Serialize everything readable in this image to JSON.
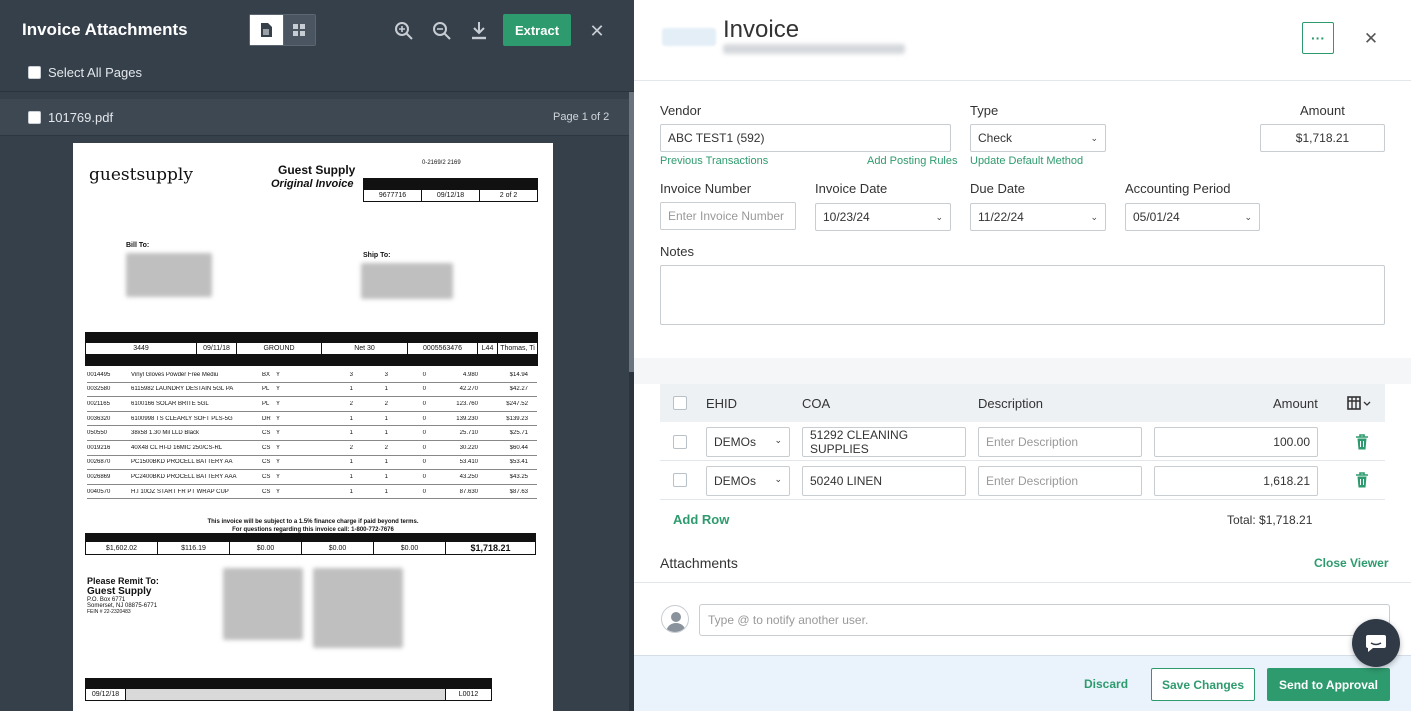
{
  "viewer": {
    "title": "Invoice Attachments",
    "extract_label": "Extract",
    "select_all_label": "Select All Pages",
    "file_name": "101769.pdf",
    "page_indicator": "Page 1 of 2"
  },
  "document": {
    "logo_text": "guestsupply",
    "company": "Guest Supply",
    "doc_type": "Original Invoice",
    "ref_code": "0-2169/2 2169",
    "header_values": [
      "9677716",
      "09/12/18",
      "2 of 2"
    ],
    "bill_to_label": "Bill To:",
    "ship_to_label": "Ship To:",
    "order_values": [
      "3449",
      "09/11/18",
      "GROUND",
      "Net 30",
      "0005563476",
      "L44",
      "Thomas, Ti"
    ],
    "items": [
      {
        "code": "0014495",
        "desc": "Vinyl Gloves Powder Free Mediu",
        "um": "BX",
        "tx": "Y",
        "q1": "3",
        "q2": "3",
        "bo": "0",
        "price": "4.980",
        "ext": "$14.94"
      },
      {
        "code": "0032580",
        "desc": "6115982 LAUNDRY DESTAIN 5GL PA",
        "um": "PL",
        "tx": "Y",
        "q1": "1",
        "q2": "1",
        "bo": "0",
        "price": "42.270",
        "ext": "$42.27"
      },
      {
        "code": "0021165",
        "desc": "6100166 SOLAR BRITE 5GL",
        "um": "PL",
        "tx": "Y",
        "q1": "2",
        "q2": "2",
        "bo": "0",
        "price": "123.760",
        "ext": "$247.52"
      },
      {
        "code": "0036320",
        "desc": "6100998 TS CLEARLY SOFT PLS-5G",
        "um": "DR",
        "tx": "Y",
        "q1": "1",
        "q2": "1",
        "bo": "0",
        "price": "139.230",
        "ext": "$139.23"
      },
      {
        "code": "050550",
        "desc": "38x58 1.30 Mil LLD Black",
        "um": "CS",
        "tx": "Y",
        "q1": "1",
        "q2": "1",
        "bo": "0",
        "price": "25.710",
        "ext": "$25.71"
      },
      {
        "code": "0019216",
        "desc": "40X48 CL HI-D 16MIC 250/CS-RL",
        "um": "CS",
        "tx": "Y",
        "q1": "2",
        "q2": "2",
        "bo": "0",
        "price": "30.220",
        "ext": "$60.44"
      },
      {
        "code": "0026870",
        "desc": "PC1500BKD PROCELL BATTERY AA",
        "um": "CS",
        "tx": "Y",
        "q1": "1",
        "q2": "1",
        "bo": "0",
        "price": "53.410",
        "ext": "$53.41"
      },
      {
        "code": "0026869",
        "desc": "PC2400BKD PROCELL BATTERY AAA",
        "um": "CS",
        "tx": "Y",
        "q1": "1",
        "q2": "1",
        "bo": "0",
        "price": "43.250",
        "ext": "$43.25"
      },
      {
        "code": "0040570",
        "desc": "H.I 10OZ START FR PT WRAP CUP",
        "um": "CS",
        "tx": "Y",
        "q1": "1",
        "q2": "1",
        "bo": "0",
        "price": "87.630",
        "ext": "$87.63"
      }
    ],
    "finance_note": "This invoice will be subject to a 1.5% finance charge if paid beyond terms.",
    "questions_note": "For questions regarding this invoice call: 1-800-772-7676",
    "totals": [
      "$1,602.02",
      "$116.19",
      "$0.00",
      "$0.00",
      "$0.00",
      "$1,718.21"
    ],
    "remit_label": "Please Remit To:",
    "remit_name": "Guest Supply",
    "remit_addr1": "P.O. Box 6771",
    "remit_addr2": "Somerset, NJ 08875-6771",
    "remit_fein": "FEIN # 22-2320483",
    "bottom_values": [
      "09/12/18",
      "L0012"
    ]
  },
  "form": {
    "title": "Invoice",
    "more_label": "···",
    "vendor_label": "Vendor",
    "vendor_value": "ABC TEST1 (592)",
    "previous_transactions": "Previous Transactions",
    "add_posting_rules": "Add Posting Rules",
    "type_label": "Type",
    "type_value": "Check",
    "update_default_method": "Update Default Method",
    "amount_label": "Amount",
    "amount_value": "$1,718.21",
    "invoice_number_label": "Invoice Number",
    "invoice_number_placeholder": "Enter Invoice Number",
    "invoice_date_label": "Invoice Date",
    "invoice_date_value": "10/23/24",
    "due_date_label": "Due Date",
    "due_date_value": "11/22/24",
    "accounting_period_label": "Accounting Period",
    "accounting_period_value": "05/01/24",
    "notes_label": "Notes"
  },
  "lines": {
    "headers": {
      "ehid": "EHID",
      "coa": "COA",
      "description": "Description",
      "amount": "Amount"
    },
    "rows": [
      {
        "ehid": "DEMOs",
        "coa": "51292 CLEANING SUPPLIES",
        "desc_placeholder": "Enter Description",
        "amount": "100.00"
      },
      {
        "ehid": "DEMOs",
        "coa": "50240 LINEN",
        "desc_placeholder": "Enter Description",
        "amount": "1,618.21"
      }
    ],
    "add_row": "Add Row",
    "total": "Total: $1,718.21"
  },
  "attachments": {
    "label": "Attachments",
    "close_viewer": "Close Viewer",
    "comment_placeholder": "Type @ to notify another user."
  },
  "footer": {
    "discard": "Discard",
    "save": "Save Changes",
    "send": "Send to Approval"
  },
  "colors": {
    "accent": "#2e9b6e",
    "viewer_bg": "#36404b"
  }
}
